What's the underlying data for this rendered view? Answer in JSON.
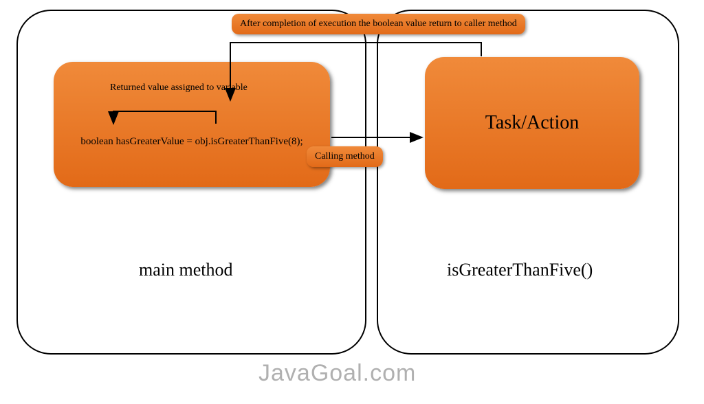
{
  "diagram": {
    "leftContainer": {
      "title": "main method",
      "codeBlock": {
        "code": "boolean hasGreaterValue = obj.isGreaterThanFive(8);",
        "innerAnnotation": "Returned value assigned to variable"
      }
    },
    "rightContainer": {
      "title": "isGreaterThanFive()",
      "taskBlock": {
        "label": "Task/Action"
      }
    },
    "topBadge": "After completion of execution the boolean value return to caller method",
    "callingBadge": "Calling method",
    "watermark": "JavaGoal.com"
  }
}
